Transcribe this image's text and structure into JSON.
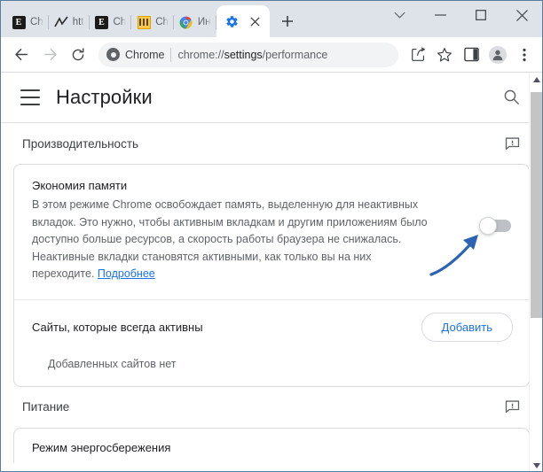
{
  "window": {
    "controls": [
      {
        "name": "tab-search-button",
        "glyph": "⌄"
      },
      {
        "name": "minimize-button",
        "glyph": "—"
      },
      {
        "name": "maximize-button",
        "glyph": "□"
      },
      {
        "name": "close-button",
        "glyph": "✕"
      }
    ]
  },
  "tabs": [
    {
      "label": "Ch",
      "favicon": "epub-e-icon",
      "active": false
    },
    {
      "label": "htt",
      "favicon": "chart-line-icon",
      "active": false
    },
    {
      "label": "Ch",
      "favicon": "epub-e-icon",
      "active": false
    },
    {
      "label": "Ch",
      "favicon": "piano-keys-icon",
      "active": false
    },
    {
      "label": "Ин",
      "favicon": "chrome-logo-icon",
      "active": false
    },
    {
      "label": "",
      "favicon": "settings-gear-icon",
      "active": true
    }
  ],
  "newtab": {
    "label": "+",
    "title": "Новая вкладка"
  },
  "toolbar": {
    "back": "←",
    "forward": "→",
    "reload": "⟳",
    "omnibox": {
      "badge": "Chrome",
      "url_prefix": "chrome://",
      "url_bold": "settings",
      "url_suffix": "/performance",
      "full_url": "chrome://settings/performance"
    },
    "share_icon": "share-icon",
    "bookmark_icon": "star-icon",
    "sidepanel_icon": "side-panel-icon",
    "profile_icon": "profile-avatar-icon",
    "menu_icon": "three-dot-menu-icon"
  },
  "settings": {
    "menu_label": "Главное меню",
    "title": "Настройки",
    "search_label": "Поиск"
  },
  "sections": {
    "performance": {
      "heading": "Производительность",
      "feedback_icon": "feedback-bubble-icon",
      "memory_saver": {
        "title": "Экономия памяти",
        "description": "В этом режиме Chrome освобождает память, выделенную для неактивных вкладок. Это нужно, чтобы активным вкладкам и другим приложениям было доступно больше ресурсов, а скорость работы браузера не снижалась. Неактивные вкладки становятся активными, как только вы на них переходите. ",
        "learn_more": "Подробнее",
        "toggle_state": "off"
      },
      "always_active_sites": {
        "label": "Сайты, которые всегда активны",
        "add_button": "Добавить",
        "empty_text": "Добавленных сайтов нет"
      }
    },
    "power": {
      "heading": "Питание",
      "feedback_icon": "feedback-bubble-icon",
      "battery_saver": {
        "title": "Режим энергосбережения"
      }
    }
  },
  "annotation": {
    "arrow_color": "#2b63b5",
    "points_to": "memory-saver-toggle"
  },
  "colors": {
    "accent": "#1a73e8",
    "titlebar": "#dee3ea",
    "text_primary": "#202124",
    "text_secondary": "#5f6368",
    "toggle_off": "#bdc1c6"
  },
  "scrollbar": {
    "up_arrow": "▲",
    "down_arrow": "▼"
  }
}
